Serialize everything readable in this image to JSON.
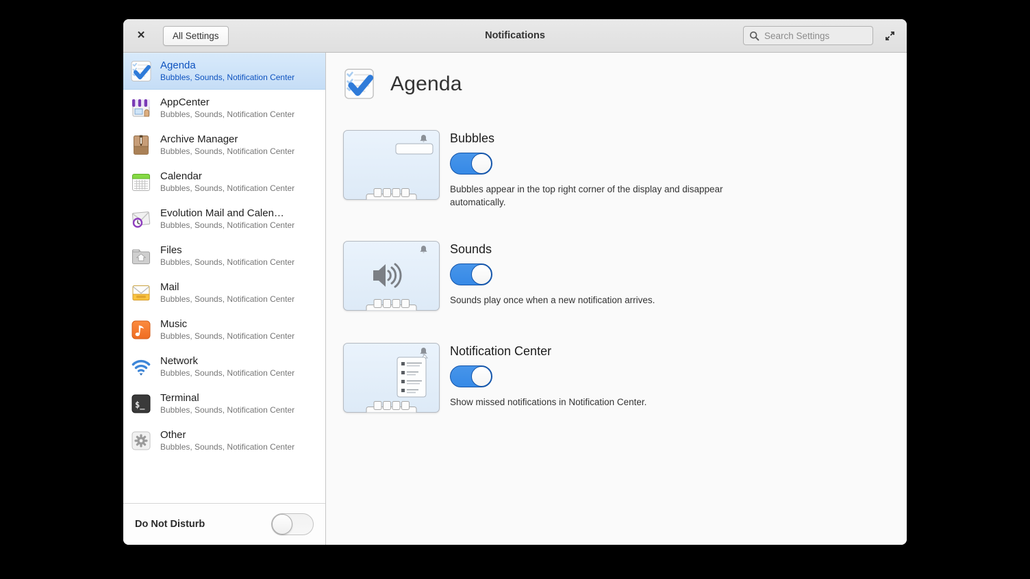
{
  "header": {
    "title": "Notifications",
    "all_settings_label": "All Settings",
    "search_placeholder": "Search Settings",
    "close_glyph": "✕"
  },
  "sidebar": {
    "items": [
      {
        "title": "Agenda",
        "subtitle": "Bubbles, Sounds, Notification Center",
        "icon": "agenda-icon",
        "selected": true
      },
      {
        "title": "AppCenter",
        "subtitle": "Bubbles, Sounds, Notification Center",
        "icon": "appcenter-icon",
        "selected": false
      },
      {
        "title": "Archive Manager",
        "subtitle": "Bubbles, Sounds, Notification Center",
        "icon": "archive-icon",
        "selected": false
      },
      {
        "title": "Calendar",
        "subtitle": "Bubbles, Sounds, Notification Center",
        "icon": "calendar-icon",
        "selected": false
      },
      {
        "title": "Evolution Mail and Calen…",
        "subtitle": "Bubbles, Sounds, Notification Center",
        "icon": "evolution-icon",
        "selected": false
      },
      {
        "title": "Files",
        "subtitle": "Bubbles, Sounds, Notification Center",
        "icon": "files-icon",
        "selected": false
      },
      {
        "title": "Mail",
        "subtitle": "Bubbles, Sounds, Notification Center",
        "icon": "mail-icon",
        "selected": false
      },
      {
        "title": "Music",
        "subtitle": "Bubbles, Sounds, Notification Center",
        "icon": "music-icon",
        "selected": false
      },
      {
        "title": "Network",
        "subtitle": "Bubbles, Sounds, Notification Center",
        "icon": "network-icon",
        "selected": false
      },
      {
        "title": "Terminal",
        "subtitle": "Bubbles, Sounds, Notification Center",
        "icon": "terminal-icon",
        "selected": false
      },
      {
        "title": "Other",
        "subtitle": "Bubbles, Sounds, Notification Center",
        "icon": "other-icon",
        "selected": false
      }
    ],
    "footer": {
      "label": "Do Not Disturb",
      "toggle_state": "off"
    }
  },
  "main": {
    "app_title": "Agenda",
    "app_icon": "agenda-icon",
    "sections": [
      {
        "title": "Bubbles",
        "toggle_state": "on",
        "description": "Bubbles appear in the top right corner of the display and disappear automatically.",
        "illustration": "bubble-illustration"
      },
      {
        "title": "Sounds",
        "toggle_state": "on",
        "description": "Sounds play once when a new notification arrives.",
        "illustration": "sound-illustration"
      },
      {
        "title": "Notification Center",
        "toggle_state": "on",
        "description": "Show missed notifications in Notification Center.",
        "illustration": "notification-center-illustration"
      }
    ]
  },
  "colors": {
    "accent": "#3689e6",
    "accent_dark": "#0d52bf",
    "selected_bg": "#cde1f7",
    "titlebar_bg": "#e4e4e4"
  }
}
